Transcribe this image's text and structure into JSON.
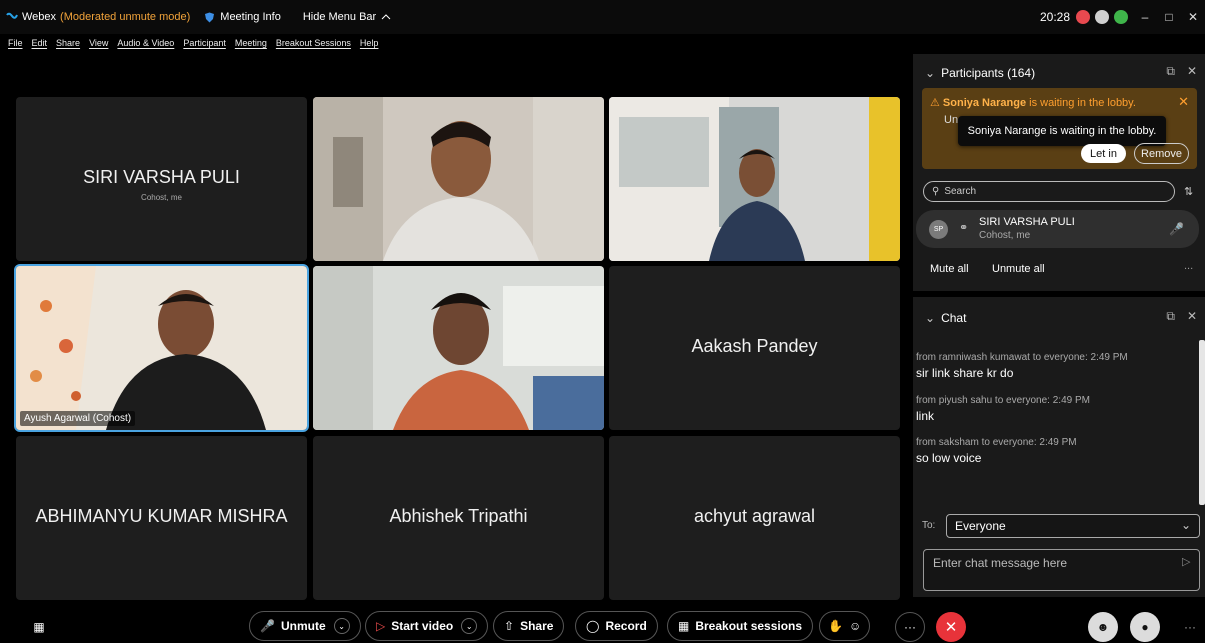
{
  "titlebar": {
    "app": "Webex",
    "mode": "(Moderated unmute mode)",
    "meeting_info": "Meeting Info",
    "hide_menu": "Hide Menu Bar",
    "clock": "20:28"
  },
  "menu": [
    "File",
    "Edit",
    "Share",
    "View",
    "Audio & Video",
    "Participant",
    "Meeting",
    "Breakout Sessions",
    "Help"
  ],
  "tiles": {
    "t1": {
      "name": "SIRI VARSHA PULI",
      "sub": "Cohost, me"
    },
    "t4": {
      "badge": "Ayush Agarwal (Cohost)"
    },
    "t6": {
      "name": "Aakash Pandey"
    },
    "t7": {
      "name": "ABHIMANYU KUMAR MISHRA"
    },
    "t8": {
      "name": "Abhishek Tripathi"
    },
    "t9": {
      "name": "achyut agrawal"
    }
  },
  "participants": {
    "title": "Participants (164)",
    "lobby_name": "Soniya Narange",
    "lobby_text": " is waiting in the lobby.",
    "lobby_partial": "Un",
    "tooltip": "Soniya Narange is waiting in the lobby.",
    "let_in": "Let in",
    "remove": "Remove",
    "search_placeholder": "Search",
    "row": {
      "initials": "SP",
      "name": "SIRI VARSHA PULI",
      "sub": "Cohost, me"
    },
    "mute_all": "Mute all",
    "unmute_all": "Unmute all",
    "more": "..."
  },
  "chat": {
    "title": "Chat",
    "messages": [
      {
        "from": "from ramniwash kumawat to everyone:   2:49 PM",
        "text": "sir link share kr do"
      },
      {
        "from": "from piyush sahu to everyone:   2:49 PM",
        "text": "link"
      },
      {
        "from": "from saksham to everyone:   2:49 PM",
        "text": "so low voice"
      }
    ],
    "to_label": "To:",
    "to_value": "Everyone",
    "input_placeholder": "Enter chat message here"
  },
  "toolbar": {
    "unmute": "Unmute",
    "start_video": "Start video",
    "share": "Share",
    "record": "Record",
    "breakout": "Breakout sessions",
    "more": "···"
  },
  "colors": {
    "accent_orange": "#f2a33a",
    "end_red": "#e8333a",
    "tile_bg": "#1e1e1e",
    "selected_border": "#4aa3e0"
  }
}
